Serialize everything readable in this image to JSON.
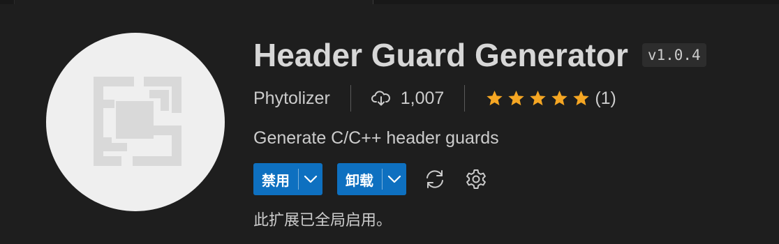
{
  "extension": {
    "name": "Header Guard Generator",
    "version": "v1.0.4",
    "publisher": "Phytolizer",
    "install_count": "1,007",
    "rating_stars": 5,
    "rating_count": "(1)",
    "description": "Generate C/C++ header guards",
    "status": "此扩展已全局启用。"
  },
  "actions": {
    "disable_label": "禁用",
    "uninstall_label": "卸载"
  },
  "icons": {
    "extension_logo": "header-guard-logo-icon",
    "installs": "cloud-download-icon",
    "star": "star-icon",
    "dropdown": "chevron-down-icon",
    "sync": "sync-icon",
    "settings": "gear-icon"
  },
  "colors": {
    "background": "#1e1e1e",
    "accent_button": "#0e70c0",
    "star": "#f5a623",
    "text": "#cccccc",
    "title": "#d7d7d7"
  }
}
